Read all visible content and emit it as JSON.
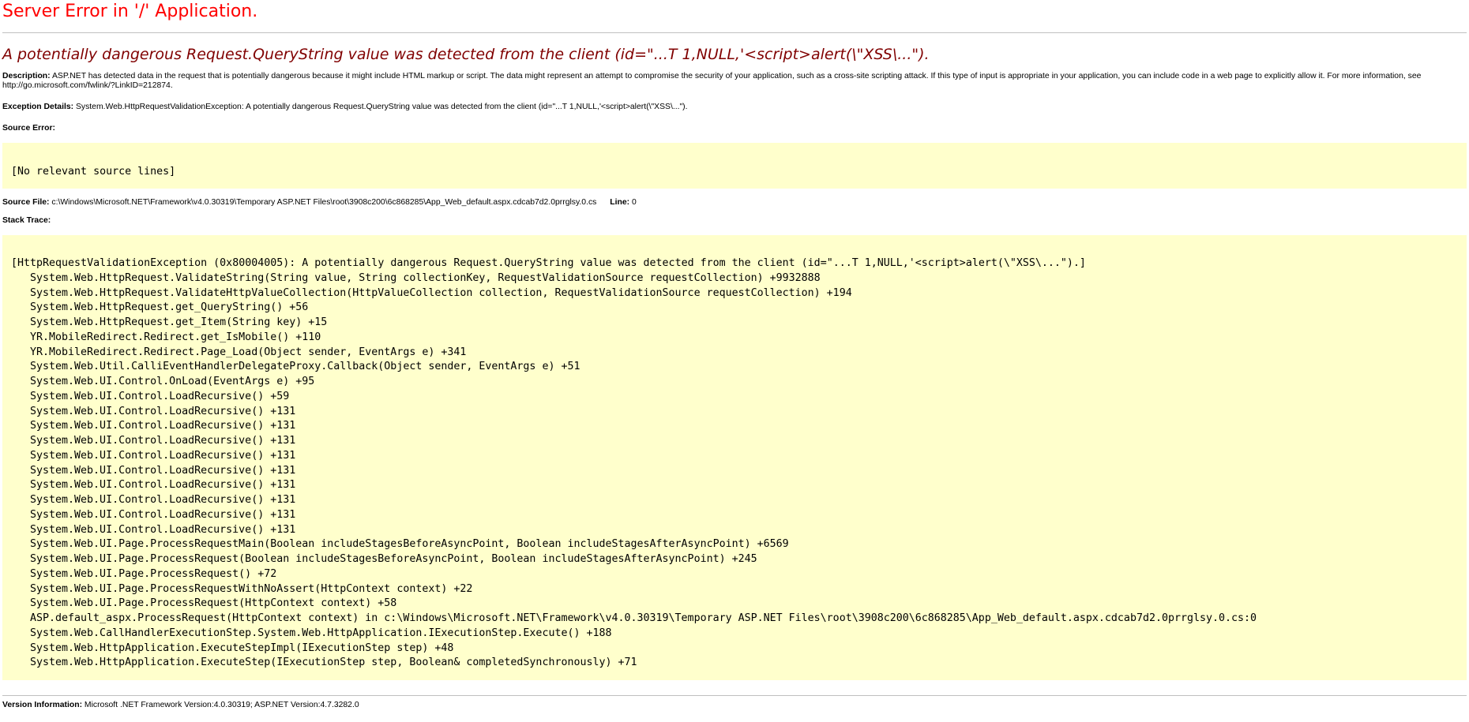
{
  "page": {
    "title": "Server Error in '/' Application.",
    "subtitle": "A potentially dangerous Request.QueryString value was detected from the client (id=\"...T 1,NULL,'<script>alert(\\\"XSS\\...\").",
    "description_label": "Description:",
    "description_text": "ASP.NET has detected data in the request that is potentially dangerous because it might include HTML markup or script. The data might represent an attempt to compromise the security of your application, such as a cross-site scripting attack. If this type of input is appropriate in your application, you can include code in a web page to explicitly allow it. For more information, see http://go.microsoft.com/fwlink/?LinkID=212874.",
    "exception_label": "Exception Details:",
    "exception_text": "System.Web.HttpRequestValidationException: A potentially dangerous Request.QueryString value was detected from the client (id=\"...T 1,NULL,'<script>alert(\\\"XSS\\...\").",
    "source_error_label": "Source Error:",
    "source_error_text": "[No relevant source lines]",
    "source_file_label": "Source File:",
    "source_file_value": "c:\\Windows\\Microsoft.NET\\Framework\\v4.0.30319\\Temporary ASP.NET Files\\root\\3908c200\\6c868285\\App_Web_default.aspx.cdcab7d2.0prrglsy.0.cs",
    "line_label": "Line:",
    "line_value": "0",
    "stack_trace_label": "Stack Trace:",
    "stack_trace": [
      "[HttpRequestValidationException (0x80004005): A potentially dangerous Request.QueryString value was detected from the client (id=\"...T 1,NULL,'<script>alert(\\\"XSS\\...\").]",
      "System.Web.HttpRequest.ValidateString(String value, String collectionKey, RequestValidationSource requestCollection) +9932888",
      "System.Web.HttpRequest.ValidateHttpValueCollection(HttpValueCollection collection, RequestValidationSource requestCollection) +194",
      "System.Web.HttpRequest.get_QueryString() +56",
      "System.Web.HttpRequest.get_Item(String key) +15",
      "YR.MobileRedirect.Redirect.get_IsMobile() +110",
      "YR.MobileRedirect.Redirect.Page_Load(Object sender, EventArgs e) +341",
      "System.Web.Util.CalliEventHandlerDelegateProxy.Callback(Object sender, EventArgs e) +51",
      "System.Web.UI.Control.OnLoad(EventArgs e) +95",
      "System.Web.UI.Control.LoadRecursive() +59",
      "System.Web.UI.Control.LoadRecursive() +131",
      "System.Web.UI.Control.LoadRecursive() +131",
      "System.Web.UI.Control.LoadRecursive() +131",
      "System.Web.UI.Control.LoadRecursive() +131",
      "System.Web.UI.Control.LoadRecursive() +131",
      "System.Web.UI.Control.LoadRecursive() +131",
      "System.Web.UI.Control.LoadRecursive() +131",
      "System.Web.UI.Control.LoadRecursive() +131",
      "System.Web.UI.Control.LoadRecursive() +131",
      "System.Web.UI.Page.ProcessRequestMain(Boolean includeStagesBeforeAsyncPoint, Boolean includeStagesAfterAsyncPoint) +6569",
      "System.Web.UI.Page.ProcessRequest(Boolean includeStagesBeforeAsyncPoint, Boolean includeStagesAfterAsyncPoint) +245",
      "System.Web.UI.Page.ProcessRequest() +72",
      "System.Web.UI.Page.ProcessRequestWithNoAssert(HttpContext context) +22",
      "System.Web.UI.Page.ProcessRequest(HttpContext context) +58",
      "ASP.default_aspx.ProcessRequest(HttpContext context) in c:\\Windows\\Microsoft.NET\\Framework\\v4.0.30319\\Temporary ASP.NET Files\\root\\3908c200\\6c868285\\App_Web_default.aspx.cdcab7d2.0prrglsy.0.cs:0",
      "System.Web.CallHandlerExecutionStep.System.Web.HttpApplication.IExecutionStep.Execute() +188",
      "System.Web.HttpApplication.ExecuteStepImpl(IExecutionStep step) +48",
      "System.Web.HttpApplication.ExecuteStep(IExecutionStep step, Boolean& completedSynchronously) +71"
    ],
    "version_label": "Version Information:",
    "version_text": "Microsoft .NET Framework Version:4.0.30319; ASP.NET Version:4.7.3282.0"
  },
  "colors": {
    "title": "#ff0000",
    "subtitle": "#800000",
    "code_background": "#ffffcc"
  }
}
